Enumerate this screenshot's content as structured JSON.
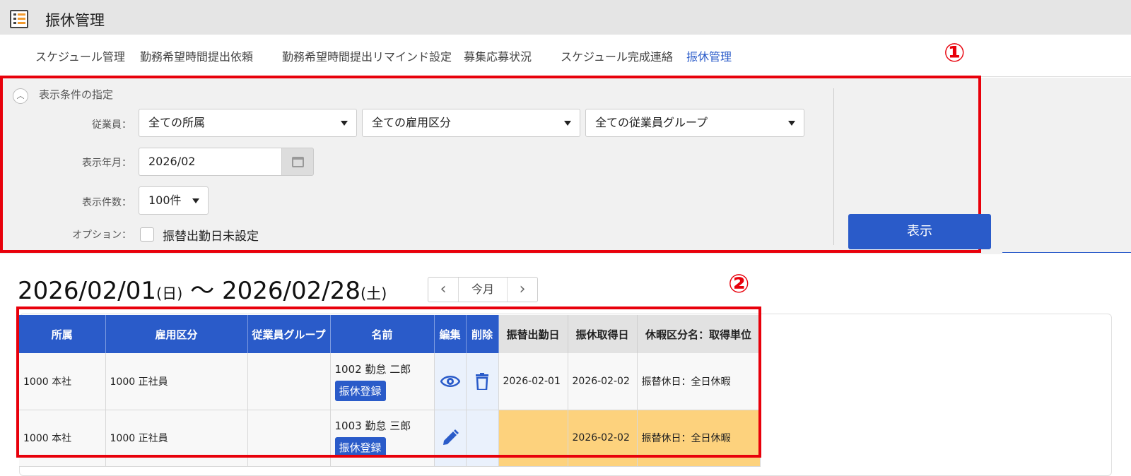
{
  "app": {
    "title": "振休管理",
    "icon": "app-schedule-icon"
  },
  "tabs": [
    {
      "label": "スケジュール管理"
    },
    {
      "label": "勤務希望時間提出依頼"
    },
    {
      "label": "勤務希望時間提出リマインド設定"
    },
    {
      "label": "募集応募状況"
    },
    {
      "label": "スケジュール完成連絡"
    },
    {
      "label": "振休管理"
    }
  ],
  "annotations": {
    "one": "①",
    "two": "②"
  },
  "filter": {
    "section_title": "表示条件の指定",
    "employee_label": "従業員：",
    "dept_value": "全ての所属",
    "employment_value": "全ての雇用区分",
    "group_value": "全ての従業員グループ",
    "month_label": "表示年月：",
    "month_value": "2026/02",
    "count_label": "表示件数：",
    "count_value": "100件",
    "option_label": "オプション：",
    "option_check_label": "振替出勤日未設定",
    "show_button": "表示"
  },
  "range": {
    "start": "2026/02/01",
    "start_dow": "(日)",
    "sep": " ～ ",
    "end": "2026/02/28",
    "end_dow": "(土)",
    "prev": "‹",
    "this_month": "今月",
    "next": "›"
  },
  "table": {
    "headers": {
      "dept": "所属",
      "employment": "雇用区分",
      "group": "従業員グループ",
      "name": "名前",
      "edit": "編集",
      "delete": "削除",
      "work_date": "振替出勤日",
      "leave_date": "振休取得日",
      "leave_type": "休暇区分名：取得単位"
    },
    "register_label": "振休登録",
    "rows": [
      {
        "dept": "1000 本社",
        "employment": "1000 正社員",
        "group": "",
        "name": "1002 勤怠 二郎",
        "edit_icon": "eye-icon",
        "delete_icon": "trash-icon",
        "work_date": "2026-02-01",
        "leave_date": "2026-02-02",
        "leave_type": "振替休日：全日休暇"
      },
      {
        "dept": "1000 本社",
        "employment": "1000 正社員",
        "group": "",
        "name": "1003 勤怠 三郎",
        "edit_icon": "pencil-icon",
        "delete_icon": "",
        "work_date": "",
        "leave_date": "2026-02-02",
        "leave_type": "振替休日：全日休暇"
      }
    ]
  },
  "colors": {
    "accent": "#2a5bc9",
    "highlight": "#fdd27d",
    "annotation_red": "#e8000b"
  }
}
